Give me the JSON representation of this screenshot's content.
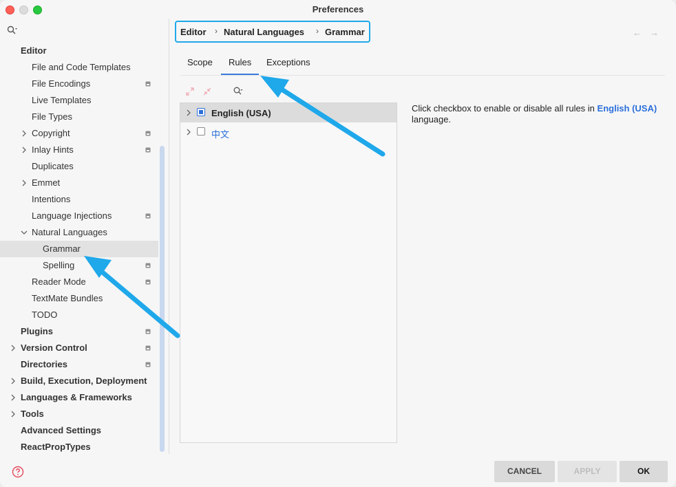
{
  "window": {
    "title": "Preferences"
  },
  "sidebar": {
    "items": [
      {
        "label": "Editor",
        "bold": true,
        "indent": 0,
        "chevron": "none",
        "badge": false
      },
      {
        "label": "File and Code Templates",
        "bold": false,
        "indent": 1,
        "chevron": "none",
        "badge": false
      },
      {
        "label": "File Encodings",
        "bold": false,
        "indent": 1,
        "chevron": "none",
        "badge": true
      },
      {
        "label": "Live Templates",
        "bold": false,
        "indent": 1,
        "chevron": "none",
        "badge": false
      },
      {
        "label": "File Types",
        "bold": false,
        "indent": 1,
        "chevron": "none",
        "badge": false
      },
      {
        "label": "Copyright",
        "bold": false,
        "indent": 1,
        "chevron": "right",
        "badge": true
      },
      {
        "label": "Inlay Hints",
        "bold": false,
        "indent": 1,
        "chevron": "right",
        "badge": true
      },
      {
        "label": "Duplicates",
        "bold": false,
        "indent": 1,
        "chevron": "none",
        "badge": false
      },
      {
        "label": "Emmet",
        "bold": false,
        "indent": 1,
        "chevron": "right",
        "badge": false
      },
      {
        "label": "Intentions",
        "bold": false,
        "indent": 1,
        "chevron": "none",
        "badge": false
      },
      {
        "label": "Language Injections",
        "bold": false,
        "indent": 1,
        "chevron": "none",
        "badge": true
      },
      {
        "label": "Natural Languages",
        "bold": false,
        "indent": 1,
        "chevron": "down",
        "badge": false
      },
      {
        "label": "Grammar",
        "bold": false,
        "indent": 2,
        "chevron": "none",
        "badge": false,
        "selected": true
      },
      {
        "label": "Spelling",
        "bold": false,
        "indent": 2,
        "chevron": "none",
        "badge": true
      },
      {
        "label": "Reader Mode",
        "bold": false,
        "indent": 1,
        "chevron": "none",
        "badge": true
      },
      {
        "label": "TextMate Bundles",
        "bold": false,
        "indent": 1,
        "chevron": "none",
        "badge": false
      },
      {
        "label": "TODO",
        "bold": false,
        "indent": 1,
        "chevron": "none",
        "badge": false
      },
      {
        "label": "Plugins",
        "bold": true,
        "indent": 0,
        "chevron": "none",
        "badge": true
      },
      {
        "label": "Version Control",
        "bold": true,
        "indent": 0,
        "chevron": "right",
        "badge": true
      },
      {
        "label": "Directories",
        "bold": true,
        "indent": 0,
        "chevron": "none",
        "badge": true
      },
      {
        "label": "Build, Execution, Deployment",
        "bold": true,
        "indent": 0,
        "chevron": "right",
        "badge": false
      },
      {
        "label": "Languages & Frameworks",
        "bold": true,
        "indent": 0,
        "chevron": "right",
        "badge": false
      },
      {
        "label": "Tools",
        "bold": true,
        "indent": 0,
        "chevron": "right",
        "badge": false
      },
      {
        "label": "Advanced Settings",
        "bold": true,
        "indent": 0,
        "chevron": "none",
        "badge": false
      },
      {
        "label": "ReactPropTypes",
        "bold": true,
        "indent": 0,
        "chevron": "none",
        "badge": false
      }
    ]
  },
  "breadcrumb": {
    "items": [
      "Editor",
      "Natural Languages",
      "Grammar"
    ]
  },
  "tabs": [
    {
      "label": "Scope",
      "active": false
    },
    {
      "label": "Rules",
      "active": true
    },
    {
      "label": "Exceptions",
      "active": false
    }
  ],
  "rules": {
    "rows": [
      {
        "label": "English (USA)",
        "state": "partial",
        "selected": true
      },
      {
        "label": "中文",
        "state": "unchecked",
        "selected": false
      }
    ]
  },
  "description": {
    "before": "Click checkbox to enable or disable all rules in ",
    "highlight": "English (USA)",
    "after": " language."
  },
  "buttons": {
    "cancel": "CANCEL",
    "apply": "APPLY",
    "ok": "OK"
  },
  "colors": {
    "accent": "#1fa8ea",
    "link": "#2a6fdb",
    "selection": "#e2e2e2"
  }
}
